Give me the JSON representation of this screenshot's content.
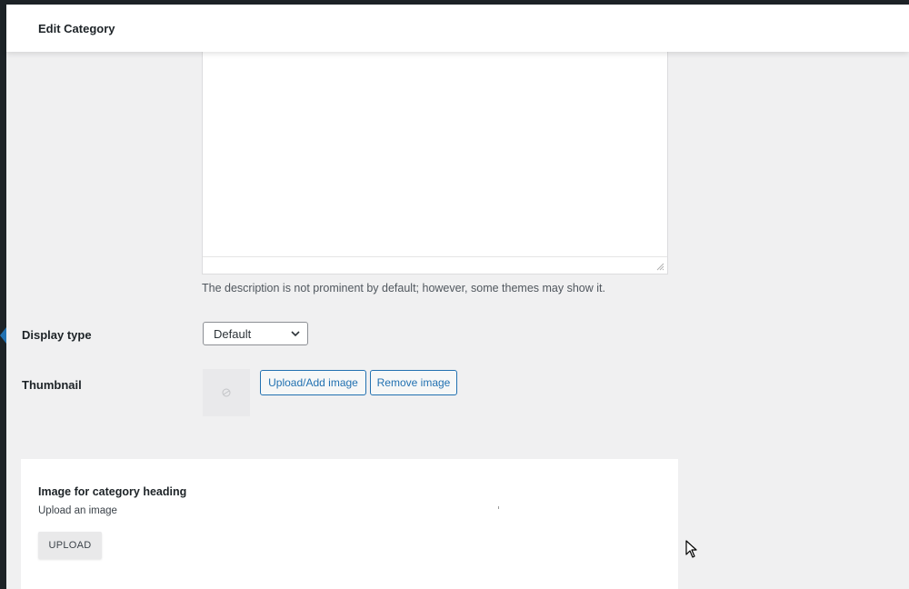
{
  "header": {
    "title": "Edit Category"
  },
  "description": {
    "note": "The description is not prominent by default; however, some themes may show it."
  },
  "display_type": {
    "label": "Display type",
    "selected": "Default"
  },
  "thumbnail": {
    "label": "Thumbnail",
    "upload_label": "Upload/Add image",
    "remove_label": "Remove image"
  },
  "category_heading": {
    "title": "Image for category heading",
    "subtitle": "Upload an image",
    "upload_label": "UPLOAD"
  },
  "colors": {
    "accent": "#2271b1",
    "background": "#f0f0f1",
    "admin_bar": "#1d2327"
  }
}
